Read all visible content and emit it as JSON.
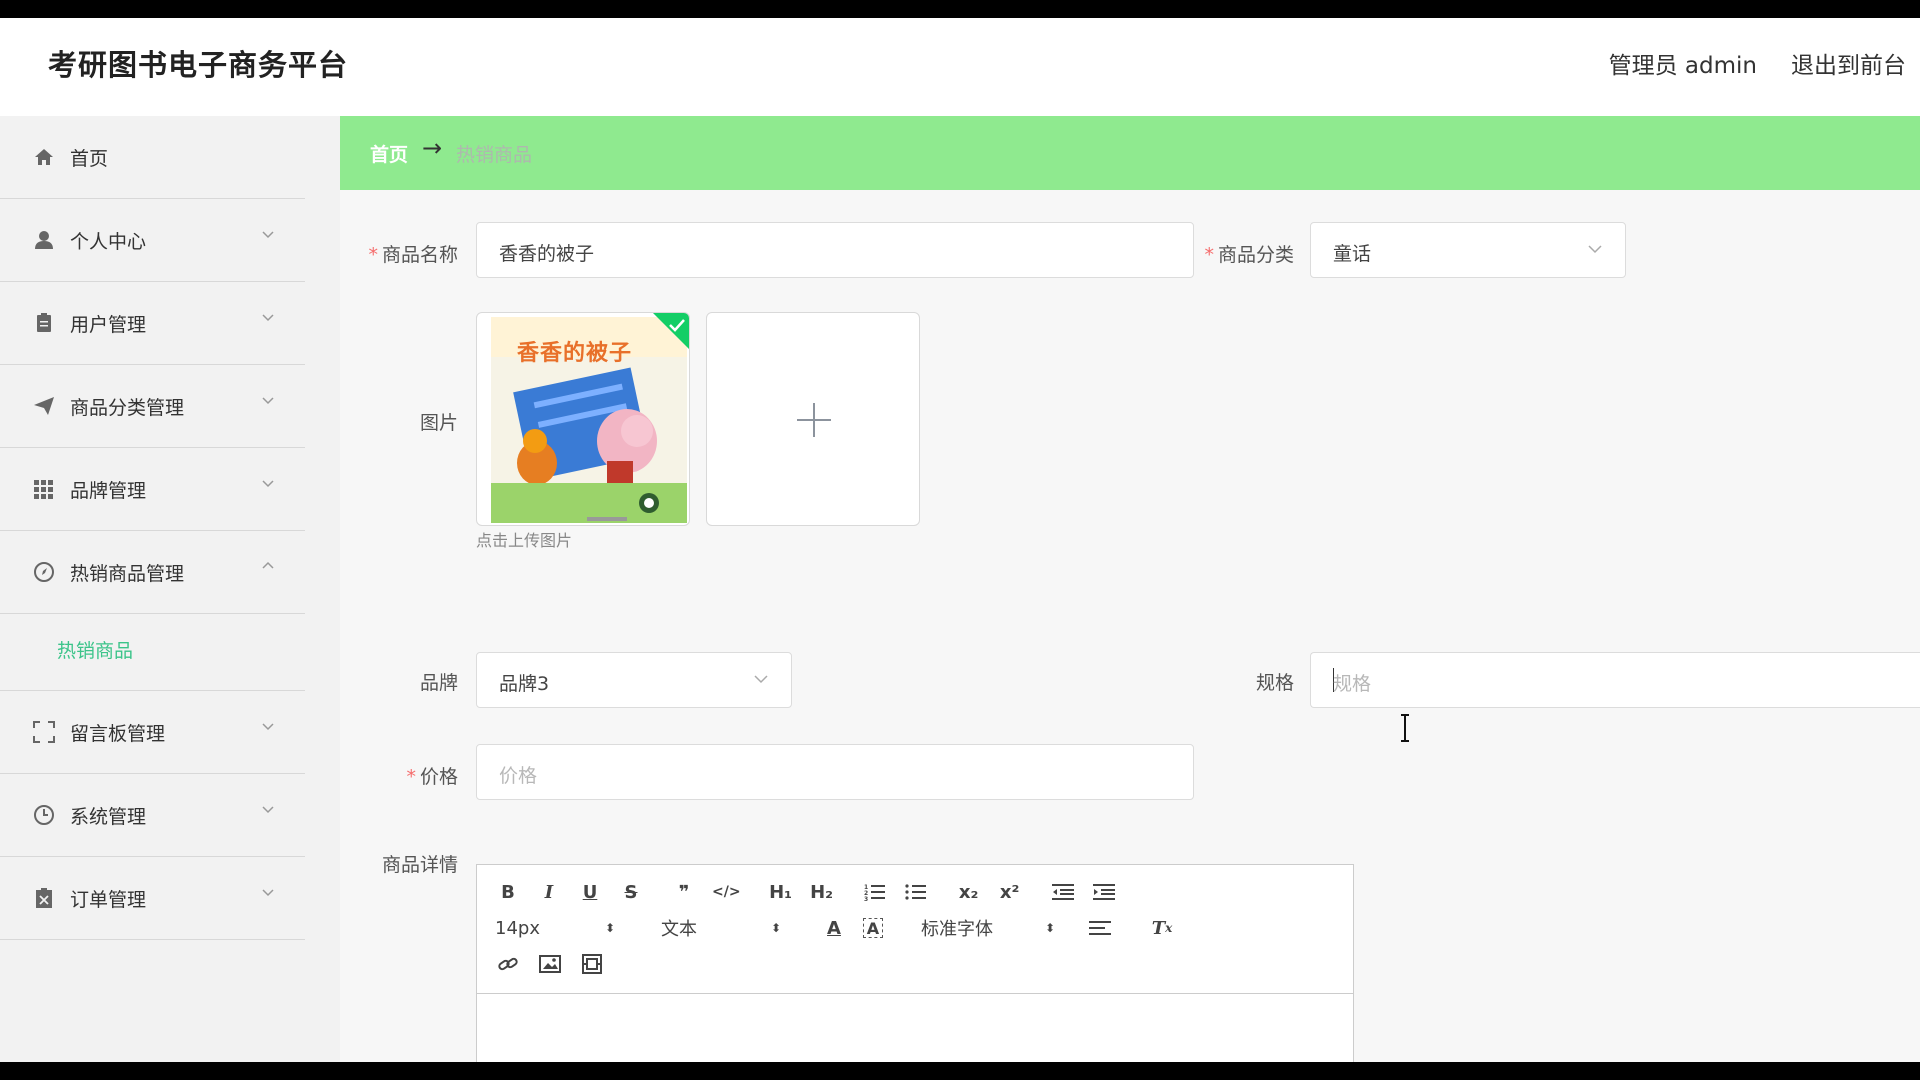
{
  "app": {
    "title": "考研图书电子商务平台"
  },
  "header": {
    "admin_label": "管理员 admin",
    "exit_label": "退出到前台"
  },
  "sidebar": {
    "items": [
      {
        "label": "首页"
      },
      {
        "label": "个人中心"
      },
      {
        "label": "用户管理"
      },
      {
        "label": "商品分类管理"
      },
      {
        "label": "品牌管理"
      },
      {
        "label": "热销商品管理"
      },
      {
        "label": "留言板管理"
      },
      {
        "label": "系统管理"
      },
      {
        "label": "订单管理"
      }
    ],
    "sub_item": "热销商品"
  },
  "breadcrumb": {
    "home": "首页",
    "separator": "→",
    "current": "热销商品"
  },
  "form": {
    "name": {
      "label": "商品名称",
      "value": "香香的被子"
    },
    "category": {
      "label": "商品分类",
      "value": "童话"
    },
    "image": {
      "label": "图片",
      "hint": "点击上传图片",
      "book_title": "香香的被子"
    },
    "brand": {
      "label": "品牌",
      "value": "品牌3"
    },
    "spec": {
      "label": "规格",
      "placeholder": "规格"
    },
    "price": {
      "label": "价格",
      "placeholder": "价格"
    },
    "detail": {
      "label": "商品详情"
    }
  },
  "editor": {
    "size_value": "14px",
    "format_value": "文本",
    "font_value": "标准字体",
    "buttons": {
      "bold": "B",
      "italic": "I",
      "underline": "U",
      "strike": "S",
      "quote": "❞",
      "code": "</>",
      "h1": "H₁",
      "h2": "H₂",
      "sub": "x₂",
      "sup": "x²"
    }
  },
  "colors": {
    "breadcrumb_bg": "#8fea8f",
    "active_menu": "#3cc48a",
    "required": "#f56c6c",
    "sidebar_bg": "#f2f2f2"
  }
}
